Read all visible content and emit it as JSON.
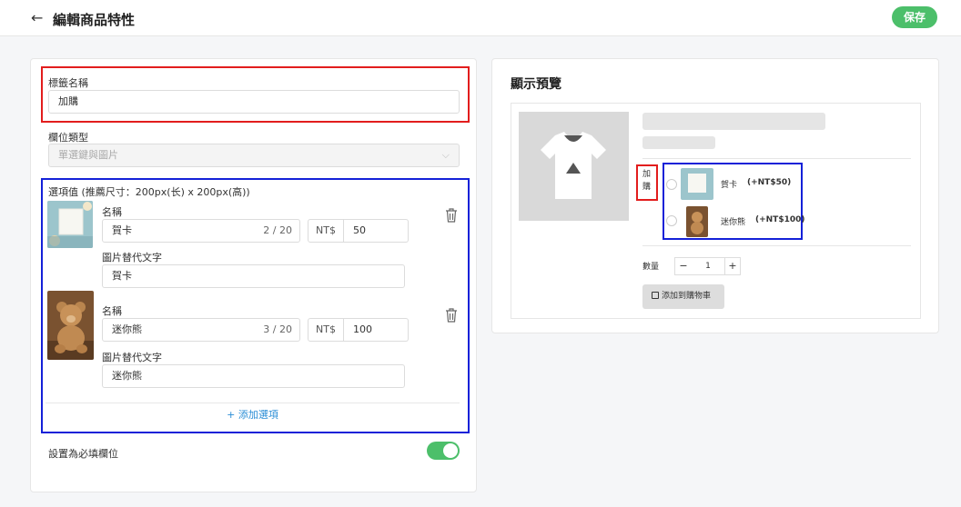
{
  "header": {
    "back_icon": "arrow-left-icon",
    "title": "編輯商品特性",
    "save_label": "保存"
  },
  "form": {
    "label_name_label": "標籤名稱",
    "label_name_value": "加購",
    "field_type_label": "欄位類型",
    "field_type_value": "單選鍵與圖片",
    "options_label": "選項值 (推薦尺寸：200px(长) x 200px(高))",
    "options": [
      {
        "name_label": "名稱",
        "name_value": "賀卡",
        "counter": "2 / 20",
        "currency": "NT$",
        "price": "50",
        "alt_label": "圖片替代文字",
        "alt_value": "賀卡"
      },
      {
        "name_label": "名稱",
        "name_value": "迷你熊",
        "counter": "3 / 20",
        "currency": "NT$",
        "price": "100",
        "alt_label": "圖片替代文字",
        "alt_value": "迷你熊"
      }
    ],
    "add_option_label": "+ 添加選項",
    "required_label": "設置為必填欄位",
    "required_on": true
  },
  "preview": {
    "title": "顯示預覽",
    "option_label": "加購",
    "choices": [
      {
        "name": "賀卡",
        "price": "(+NT$50)"
      },
      {
        "name": "迷你熊",
        "price": "(+NT$100)"
      }
    ],
    "qty_label": "數量",
    "qty_minus": "−",
    "qty_value": "1",
    "qty_plus": "+",
    "add_to_cart": "添加到購物車"
  },
  "colors": {
    "accent_green": "#4cbf6a",
    "highlight_red": "#e21d1d",
    "highlight_blue": "#1421d8",
    "link_blue": "#2b8ed6"
  }
}
